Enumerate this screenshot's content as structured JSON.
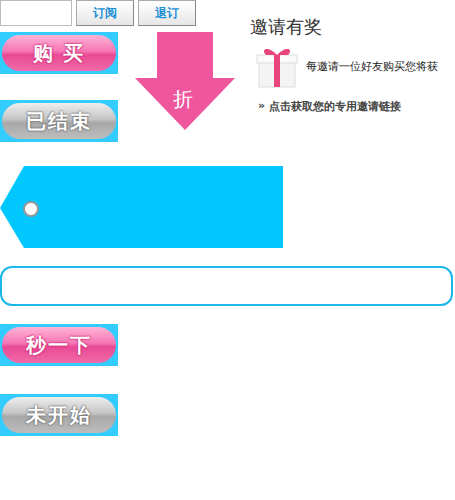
{
  "subscribe": {
    "value": "",
    "buttons": [
      "订阅",
      "退订"
    ]
  },
  "top_buttons": [
    {
      "label": "购 买",
      "kind": "pink"
    },
    {
      "label": "已结束",
      "kind": "grey"
    }
  ],
  "discount_arrow": "折",
  "invite": {
    "title": "邀请有奖",
    "text": "每邀请一位好友购买您将获",
    "link_marker": "»",
    "link": "点击获取您的专用邀请链接"
  },
  "wide_field": {
    "value": ""
  },
  "bottom_buttons": [
    {
      "label": "秒一下",
      "kind": "pink"
    },
    {
      "label": "未开始",
      "kind": "grey"
    }
  ]
}
